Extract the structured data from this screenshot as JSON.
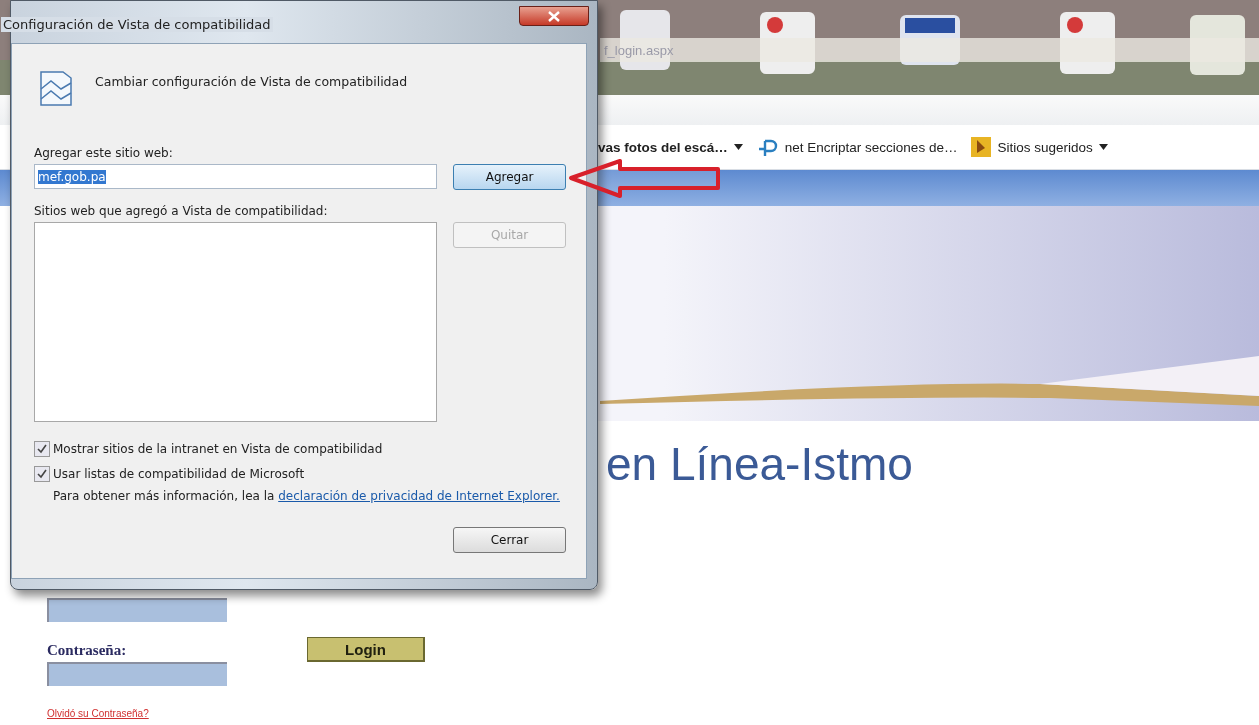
{
  "browser": {
    "address": "f_login.aspx",
    "favorites": [
      {
        "label": "vas fotos del escá…",
        "kind": "menu"
      },
      {
        "label": "net Encriptar secciones de…",
        "kind": "slice"
      },
      {
        "label": "Sitios sugeridos",
        "kind": "suggested"
      }
    ]
  },
  "page": {
    "title": "en Línea-Istmo",
    "password_label": "Contraseña:",
    "login_button": "Login",
    "forgot_link": "Olvidó su Contraseña?"
  },
  "dialog": {
    "title": "Configuración de Vista de compatibilidad",
    "heading": "Cambiar configuración de Vista de compatibilidad",
    "add_label": "Agregar este sitio web:",
    "add_field": {
      "value": "mef.gob.pa",
      "selected": true
    },
    "add_button": {
      "label": "Agregar",
      "disabled": false
    },
    "sites_label": "Sitios web que agregó a Vista de compatibilidad:",
    "remove_button": {
      "label": "Quitar",
      "disabled": true
    },
    "checkboxes": [
      {
        "label": "Mostrar sitios de la intranet en Vista de compatibilidad",
        "checked": true
      },
      {
        "label": "Usar listas de compatibilidad de Microsoft",
        "checked": true
      }
    ],
    "privacy_note": {
      "text": "Para obtener más información, lea la ",
      "link": "declaración de privacidad de Internet Explorer."
    },
    "close_button": {
      "label": "Cerrar",
      "disabled": false
    }
  }
}
